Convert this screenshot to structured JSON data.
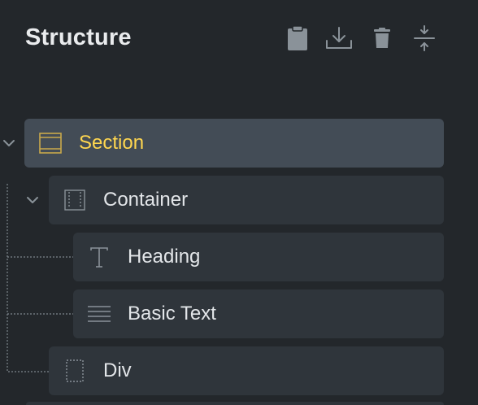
{
  "panel": {
    "title": "Structure"
  },
  "toolbar": {
    "icons": [
      "clipboard-icon",
      "download-icon",
      "trash-icon",
      "expand-collapse-icon"
    ]
  },
  "tree": {
    "nodes": [
      {
        "label": "Section",
        "icon": "section-icon",
        "depth": 0,
        "expanded": true,
        "active": true
      },
      {
        "label": "Container",
        "icon": "container-icon",
        "depth": 1,
        "expanded": true,
        "active": false
      },
      {
        "label": "Heading",
        "icon": "heading-icon",
        "depth": 2,
        "active": false
      },
      {
        "label": "Basic Text",
        "icon": "basic-text-icon",
        "depth": 2,
        "active": false
      },
      {
        "label": "Div",
        "icon": "div-icon",
        "depth": 1,
        "active": false
      }
    ]
  },
  "colors": {
    "background": "#23272b",
    "node": "#2f353b",
    "node_active": "#434c56",
    "accent": "#ffd64f",
    "text": "#e3e6e9",
    "icon": "#8a9299"
  }
}
